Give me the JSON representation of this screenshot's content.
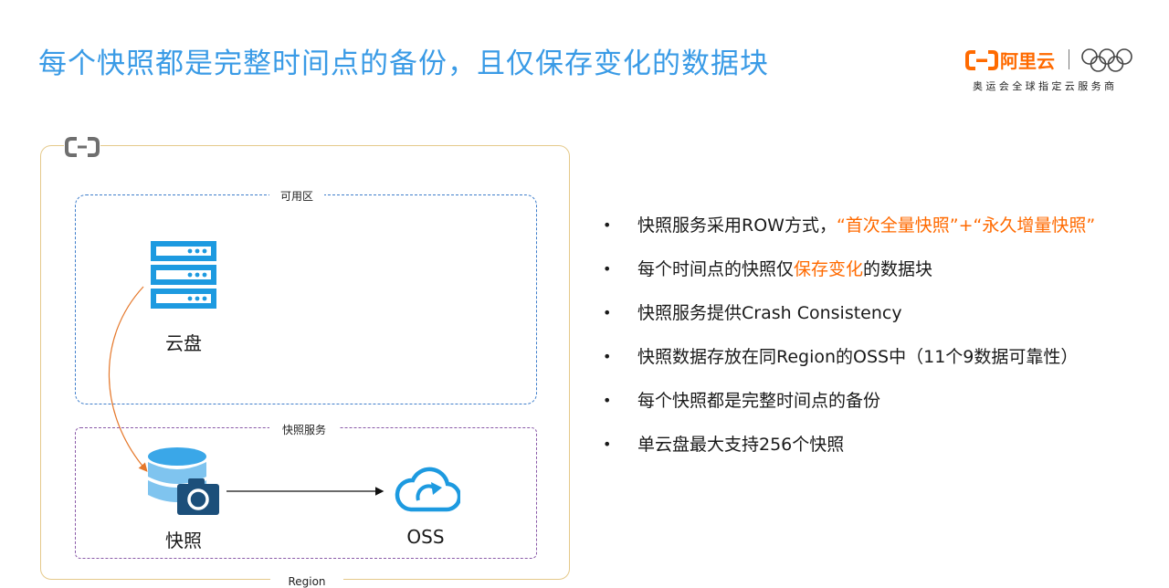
{
  "header": {
    "title": "每个快照都是完整时间点的备份，且仅保存变化的数据块"
  },
  "branding": {
    "logo_text": "阿里云",
    "logo_subtitle": "奥运会全球指定云服务商",
    "brand_color": "#ff6a00",
    "title_color": "#3a9be6"
  },
  "diagram": {
    "region_label": "Region",
    "zone_label": "可用区",
    "service_label": "快照服务",
    "disk_label": "云盘",
    "snapshot_label": "快照",
    "oss_label": "OSS",
    "icons": [
      "aliyun-logo-icon",
      "server-stack-icon",
      "database-camera-icon",
      "cloud-upload-icon"
    ]
  },
  "bullets": [
    {
      "parts": [
        {
          "text": "快照服务采用ROW方式，"
        },
        {
          "text": "“首次全量快照”+“永久增量快照”",
          "hl": true
        }
      ]
    },
    {
      "parts": [
        {
          "text": "每个时间点的快照仅"
        },
        {
          "text": "保存变化",
          "hl": true
        },
        {
          "text": "的数据块"
        }
      ]
    },
    {
      "parts": [
        {
          "text": "快照服务提供Crash Consistency"
        }
      ]
    },
    {
      "parts": [
        {
          "text": "快照数据存放在同Region的OSS中（11个9数据可靠性）"
        }
      ]
    },
    {
      "parts": [
        {
          "text": "每个快照都是完整时间点的备份"
        }
      ]
    },
    {
      "parts": [
        {
          "text": "单云盘最大支持256个快照"
        }
      ]
    }
  ]
}
